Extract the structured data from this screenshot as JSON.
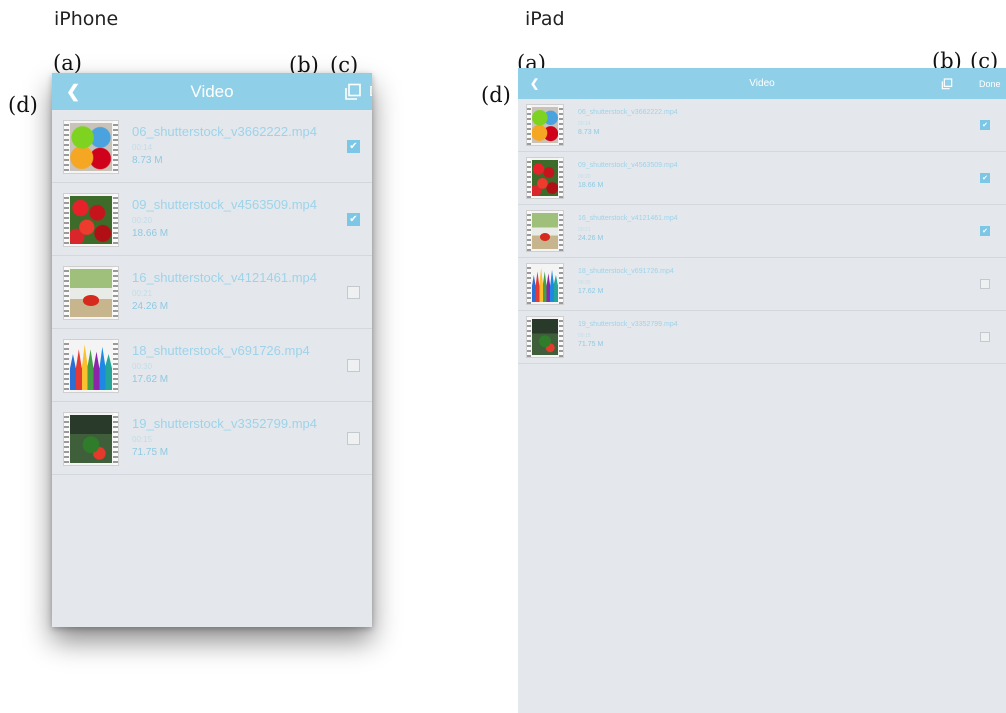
{
  "labels": {
    "iphone": "iPhone",
    "ipad": "iPad",
    "a": "(a)",
    "b": "(b)",
    "c": "(c)",
    "d": "(d)"
  },
  "app": {
    "title": "Video",
    "back_icon": "chevron-left-icon",
    "copy_icon": "copy-icon",
    "done_label": "Done",
    "accent_color": "#8fd0e8"
  },
  "files": [
    {
      "name": "06_shutterstock_v3662222.mp4",
      "duration": "00:14",
      "size": "8.73 M",
      "checked": true,
      "thumb": "paint-cans-image"
    },
    {
      "name": "09_shutterstock_v4563509.mp4",
      "duration": "00:20",
      "size": "18.66 M",
      "checked": true,
      "thumb": "strawberries-image"
    },
    {
      "name": "16_shutterstock_v4121461.mp4",
      "duration": "00:21",
      "size": "24.26 M",
      "checked": false,
      "thumb": "table-setting-image"
    },
    {
      "name": "18_shutterstock_v691726.mp4",
      "duration": "00:30",
      "size": "17.62 M",
      "checked": false,
      "thumb": "crayons-image"
    },
    {
      "name": "19_shutterstock_v3352799.mp4",
      "duration": "00:15",
      "size": "71.75 M",
      "checked": false,
      "thumb": "garden-image"
    }
  ],
  "ipad_checked": [
    true,
    true,
    true,
    false,
    false
  ]
}
